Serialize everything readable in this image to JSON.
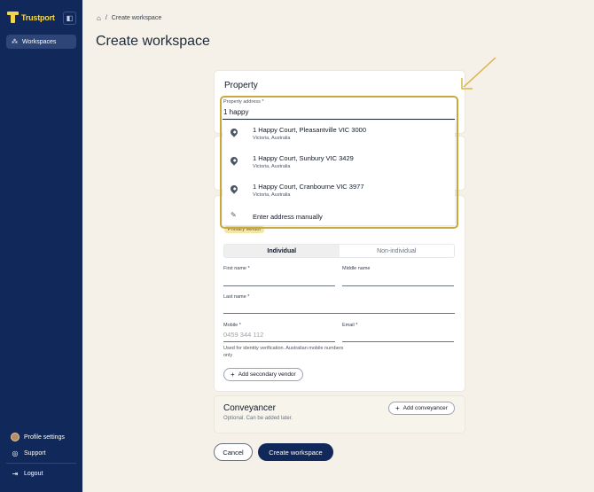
{
  "app": {
    "brand": "Trustport"
  },
  "sidebar": {
    "nav": [
      {
        "label": "Workspaces",
        "icon": "workspaces-icon"
      }
    ],
    "bottom": [
      {
        "label": "Profile settings",
        "icon": "avatar"
      },
      {
        "label": "Support",
        "icon": "support-icon"
      },
      {
        "label": "Logout",
        "icon": "logout-icon"
      }
    ]
  },
  "breadcrumb": {
    "separator": "/",
    "current": "Create workspace"
  },
  "page": {
    "title": "Create workspace"
  },
  "property": {
    "heading": "Property",
    "address_label": "Property address *",
    "address_value": "1 happy",
    "suggestions": [
      {
        "main": "1 Happy Court, Pleasantville VIC 3000",
        "sub": "Victoria, Australia"
      },
      {
        "main": "1 Happy Court, Sunbury VIC 3429",
        "sub": "Victoria, Australia"
      },
      {
        "main": "1 Happy Court, Cranbourne VIC 3977",
        "sub": "Victoria, Australia"
      }
    ],
    "manual_label": "Enter address manually"
  },
  "vendor": {
    "badge": "Primary vendor",
    "tabs": [
      "Individual",
      "Non-individual"
    ],
    "active_tab": "Individual",
    "first_name_label": "First name *",
    "middle_name_label": "Middle name",
    "last_name_label": "Last name *",
    "mobile_label": "Mobile *",
    "mobile_placeholder": "0459 344 112",
    "email_label": "Email *",
    "mobile_helper": "Used for identity verification. Australian mobile numbers only",
    "add_secondary": "Add secondary vendor"
  },
  "conveyancer": {
    "title": "Conveyancer",
    "subtitle": "Optional. Can be added later.",
    "add_label": "Add conveyancer"
  },
  "actions": {
    "cancel": "Cancel",
    "create": "Create workspace"
  },
  "colors": {
    "sidebar": "#11295a",
    "accent": "#f4d64e",
    "highlight": "#c9a93c",
    "background": "#f5f1e8"
  }
}
